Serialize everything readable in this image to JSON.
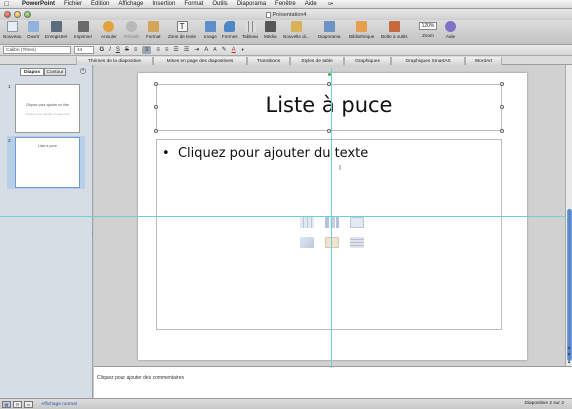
{
  "menubar": {
    "apple": "",
    "items": [
      "PowerPoint",
      "Fichier",
      "Édition",
      "Affichage",
      "Insertion",
      "Format",
      "Outils",
      "Diaporama",
      "Fenêtre",
      "Aide"
    ]
  },
  "window": {
    "title": "Présentation4"
  },
  "toolbar": {
    "buttons": [
      {
        "label": "Nouveau",
        "icon": "new-doc-icon",
        "color": "#e9eef5"
      },
      {
        "label": "Ouvrir",
        "icon": "open-folder-icon",
        "color": "#8fb2df"
      },
      {
        "label": "Enregistrer",
        "icon": "save-icon",
        "color": "#5b6b80"
      },
      {
        "label": "Imprimer",
        "icon": "print-icon",
        "color": "#6b6b6b"
      },
      {
        "label": "Annuler",
        "icon": "undo-icon",
        "color": "#e3a23b"
      },
      {
        "label": "Rétablir",
        "icon": "redo-icon",
        "color": "#b8b8b8"
      },
      {
        "label": "Format",
        "icon": "format-painter-icon",
        "color": "#d3a45b"
      },
      {
        "label": "Zone de texte",
        "icon": "textbox-icon",
        "color": "#f4f4f4"
      },
      {
        "label": "Image",
        "icon": "image-icon",
        "color": "#5e8dc9"
      },
      {
        "label": "Formes",
        "icon": "shapes-icon",
        "color": "#4f86c6"
      },
      {
        "label": "Tableau",
        "icon": "table-icon",
        "color": "#dcdcdc"
      },
      {
        "label": "Média",
        "icon": "media-icon",
        "color": "#555555"
      },
      {
        "label": "Nouvelle di...",
        "icon": "new-slide-icon",
        "color": "#d7b25a"
      },
      {
        "label": "Diaporama",
        "icon": "slideshow-icon",
        "color": "#6b93c6"
      },
      {
        "label": "Bibliothèque",
        "icon": "library-icon",
        "color": "#e5a04f"
      },
      {
        "label": "Boîte à outils",
        "icon": "toolbox-icon",
        "color": "#c46a3c"
      },
      {
        "label": "Zoom",
        "icon": "zoom-icon",
        "color": "#ffffff"
      },
      {
        "label": "Aide",
        "icon": "help-icon",
        "color": "#7f71c8"
      }
    ],
    "zoom_value": "120%"
  },
  "formatbar": {
    "font": "Calibri (Titres)",
    "size": "44",
    "buttons": [
      "G",
      "I",
      "S",
      "S",
      "",
      "",
      "",
      "",
      "A",
      "A",
      "",
      "A"
    ]
  },
  "ribbon": {
    "tabs": [
      "Thèmes de la diapositive",
      "Mises en page des diapositives",
      "Transitions",
      "Styles de table",
      "Graphiques",
      "Graphiques SmartArt",
      "WordArt"
    ]
  },
  "leftpane": {
    "tab_slides": "Diapos",
    "tab_outline": "Contour",
    "close": "×",
    "slides": [
      {
        "num": "1",
        "title": "Cliquez pour ajouter un titre",
        "subtitle": "Cliquez pour ajouter un sous-titre"
      },
      {
        "num": "2",
        "title": "Liste à puce",
        "subtitle": ""
      }
    ]
  },
  "slide": {
    "title": "Liste à puce",
    "bullet": "Cliquez pour ajouter du texte",
    "content_icons": [
      "table-insert-icon",
      "chart-insert-icon",
      "smartart-insert-icon",
      "picture-insert-icon",
      "clipart-insert-icon",
      "movie-insert-icon"
    ]
  },
  "notes": {
    "placeholder": "Cliquez pour ajouter des commentaires"
  },
  "status": {
    "view": "Affichage normal",
    "slide_count": "Diapositive 2 sur 2"
  }
}
